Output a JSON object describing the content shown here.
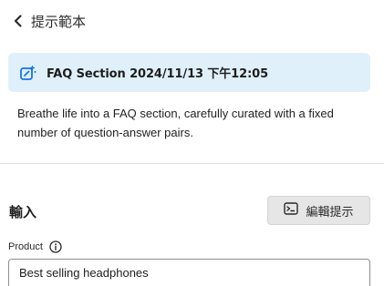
{
  "nav": {
    "back_label": "提示範本"
  },
  "banner": {
    "title": "FAQ Section 2024/11/13 下午12:05",
    "icon": "sparkle-edit-icon"
  },
  "description": "Breathe life into a FAQ section, carefully curated with a fixed number of question-answer pairs.",
  "input_section": {
    "title": "輸入",
    "edit_button_label": "編輯提示",
    "edit_button_icon": "terminal-prompt-icon"
  },
  "field": {
    "label": "Product",
    "value": "Best selling headphones"
  },
  "colors": {
    "banner_bg": "#e0f0fb",
    "accent": "#1473e6",
    "button_bg": "#e6e6e6"
  }
}
